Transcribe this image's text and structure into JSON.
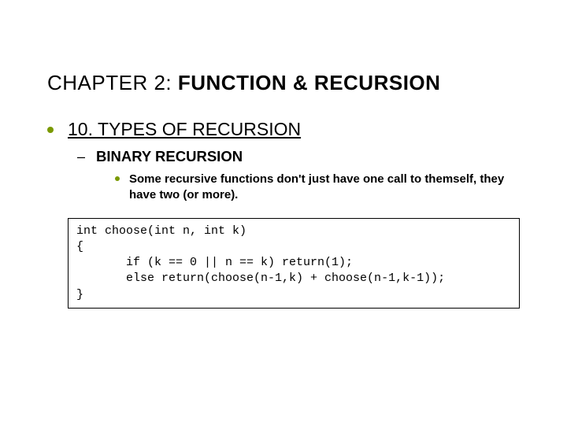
{
  "title_prefix": "CHAPTER 2: ",
  "title_bold": "FUNCTION & RECURSION",
  "section": "10. TYPES OF RECURSION",
  "subsection": "BINARY RECURSION",
  "body": "Some recursive functions don't just have one call to themself, they have two (or more).",
  "code": "int choose(int n, int k)\n{\n       if (k == 0 || n == k) return(1);\n       else return(choose(n-1,k) + choose(n-1,k-1));\n}"
}
